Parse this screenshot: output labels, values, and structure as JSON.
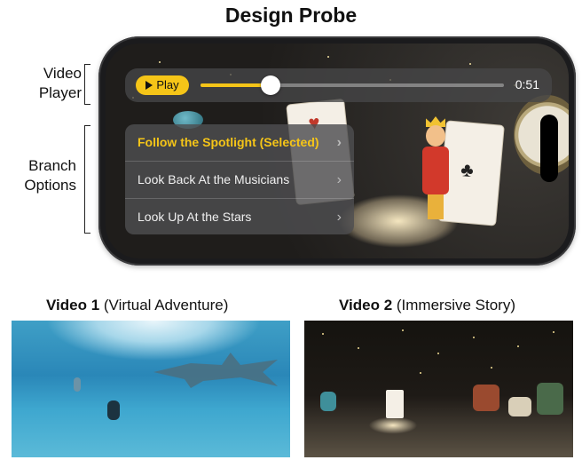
{
  "title": "Design Probe",
  "annotations": {
    "video_player": [
      "Video",
      "Player"
    ],
    "branch_options": [
      "Branch",
      "Options"
    ]
  },
  "player": {
    "play_label": "Play",
    "time": "0:51",
    "progress": 0.23
  },
  "branches": [
    {
      "label": "Follow the Spotlight (Selected)",
      "selected": true
    },
    {
      "label": "Look Back At the Musicians",
      "selected": false
    },
    {
      "label": "Look Up At the Stars",
      "selected": false
    }
  ],
  "videos": [
    {
      "name": "Video 1",
      "desc": "(Virtual Adventure)"
    },
    {
      "name": "Video 2",
      "desc": "(Immersive Story)"
    }
  ],
  "colors": {
    "accent": "#f5c518"
  }
}
